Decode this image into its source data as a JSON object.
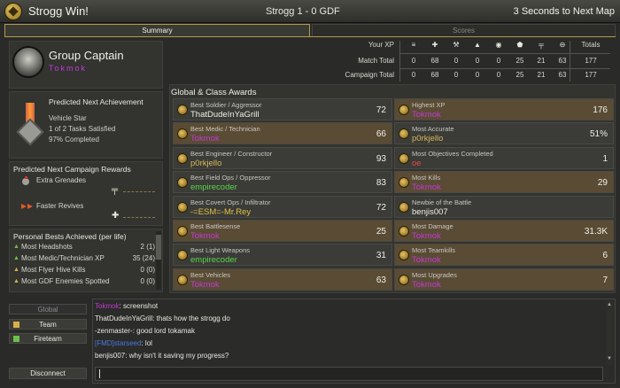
{
  "header": {
    "title": "Strogg Win!",
    "score": "Strogg 1 - 0 GDF",
    "countdown": "3 Seconds to Next Map"
  },
  "tabs": [
    {
      "label": "Summary",
      "active": true
    },
    {
      "label": "Scores",
      "active": false
    }
  ],
  "profile": {
    "rank": "Group Captain",
    "name": "Tokmok",
    "name_color": "#c23ad6"
  },
  "stats": {
    "headers": {
      "label": "Your XP",
      "totals": "Totals"
    },
    "icons": [
      "rank-icon",
      "medic-icon",
      "engineer-icon",
      "fieldops-icon",
      "covert-icon",
      "battlesense-icon",
      "weapons-icon",
      "vehicles-icon"
    ],
    "rows": [
      {
        "label": "Match Total",
        "values": [
          "0",
          "68",
          "0",
          "0",
          "0",
          "25",
          "21",
          "63"
        ],
        "total": "177"
      },
      {
        "label": "Campaign Total",
        "values": [
          "0",
          "68",
          "0",
          "0",
          "0",
          "25",
          "21",
          "63"
        ],
        "total": "177"
      }
    ]
  },
  "prediction": {
    "title": "Predicted Next Achievement",
    "name": "Vehicle Star",
    "tasks": "1 of 2 Tasks Satisfied",
    "progress": "97% Completed"
  },
  "rewards": {
    "title": "Predicted Next Campaign Rewards",
    "items": [
      {
        "label": "Extra Grenades"
      },
      {
        "label": "Faster Revives"
      }
    ]
  },
  "bests": {
    "title": "Personal Bests Achieved (per life)",
    "rows": [
      {
        "label": "Most Headshots",
        "value": "2 (1)",
        "arrow_color": "#6cc04a"
      },
      {
        "label": "Most Medic/Technician XP",
        "value": "35 (24)",
        "arrow_color": "#6cc04a"
      },
      {
        "label": "Most Flyer Hive Kills",
        "value": "0 (0)",
        "arrow_color": "#d9b04a"
      },
      {
        "label": "Most GDF Enemies Spotted",
        "value": "0 (0)",
        "arrow_color": "#d9b04a"
      }
    ]
  },
  "awards": {
    "title": "Global & Class Awards",
    "left": [
      {
        "name": "Best Soldier / Aggressor",
        "player": "ThatDudeInYaGrill",
        "player_color": "#f0f0e8",
        "value": "72",
        "highlight": false
      },
      {
        "name": "Best Medic / Technician",
        "player": "Tokmok",
        "player_color": "#c23ad6",
        "value": "66",
        "highlight": true
      },
      {
        "name": "Best Engineer / Constructor",
        "player": "p0rkjello",
        "player_color": "#d9b85a",
        "value": "93",
        "highlight": false
      },
      {
        "name": "Best Field Ops / Oppressor",
        "player": "empirecoder",
        "player_color": "#59d64a",
        "value": "83",
        "highlight": false
      },
      {
        "name": "Best Covert Ops / Infiltrator",
        "player": "-=ESM=-Mr.Rey",
        "player_color": "#e0c24a",
        "value": "72",
        "highlight": false
      },
      {
        "name": "Best Battlesense",
        "player": "Tokmok",
        "player_color": "#c23ad6",
        "value": "25",
        "highlight": true
      },
      {
        "name": "Best Light Weapons",
        "player": "empirecoder",
        "player_color": "#59d64a",
        "value": "31",
        "highlight": false
      },
      {
        "name": "Best Vehicles",
        "player": "Tokmok",
        "player_color": "#c23ad6",
        "value": "63",
        "highlight": true
      }
    ],
    "right": [
      {
        "name": "Highest XP",
        "player": "Tokmok",
        "player_color": "#c23ad6",
        "value": "176",
        "highlight": true
      },
      {
        "name": "Most Accurate",
        "player": "p0rkjello",
        "player_color": "#d9b85a",
        "value": "51%",
        "highlight": false
      },
      {
        "name": "Most Objectives Completed",
        "player": "oe",
        "player_color": "#e04a4a",
        "value": "1",
        "highlight": false
      },
      {
        "name": "Most Kills",
        "player": "Tokmok",
        "player_color": "#c23ad6",
        "value": "29",
        "highlight": true
      },
      {
        "name": "Newbie of the Battle",
        "player": "benjis007",
        "player_color": "#f0f0e8",
        "value": "",
        "highlight": false
      },
      {
        "name": "Most Damage",
        "player": "Tokmok",
        "player_color": "#c23ad6",
        "value": "31.3K",
        "highlight": true
      },
      {
        "name": "Most Teamkills",
        "player": "Tokmok",
        "player_color": "#c23ad6",
        "value": "6",
        "highlight": true
      },
      {
        "name": "Most Upgrades",
        "player": "Tokmok",
        "player_color": "#c23ad6",
        "value": "7",
        "highlight": true
      }
    ]
  },
  "chat": {
    "buttons": [
      {
        "label": "Global",
        "enabled": false
      },
      {
        "label": "Team",
        "enabled": true
      },
      {
        "label": "Fireteam",
        "enabled": true
      }
    ],
    "disconnect": "Disconnect",
    "lines": [
      {
        "speaker": "Tokmok",
        "speaker_color": "#c23ad6",
        "text": ": screenshot"
      },
      {
        "speaker": "ThatDudeInYaGrill",
        "speaker_color": "#e8e8e0",
        "text": ": thats how the strogg do"
      },
      {
        "speaker": "-zenmaster-",
        "speaker_color": "#e8e8e0",
        "text": ": good lord tokamak"
      },
      {
        "speaker": "[FMD]starseed",
        "speaker_color": "#4a7ae0",
        "text": ": lol"
      },
      {
        "speaker": "benjis007",
        "speaker_color": "#e8e8e0",
        "text": ": why isn't it saving my progress?"
      }
    ]
  }
}
